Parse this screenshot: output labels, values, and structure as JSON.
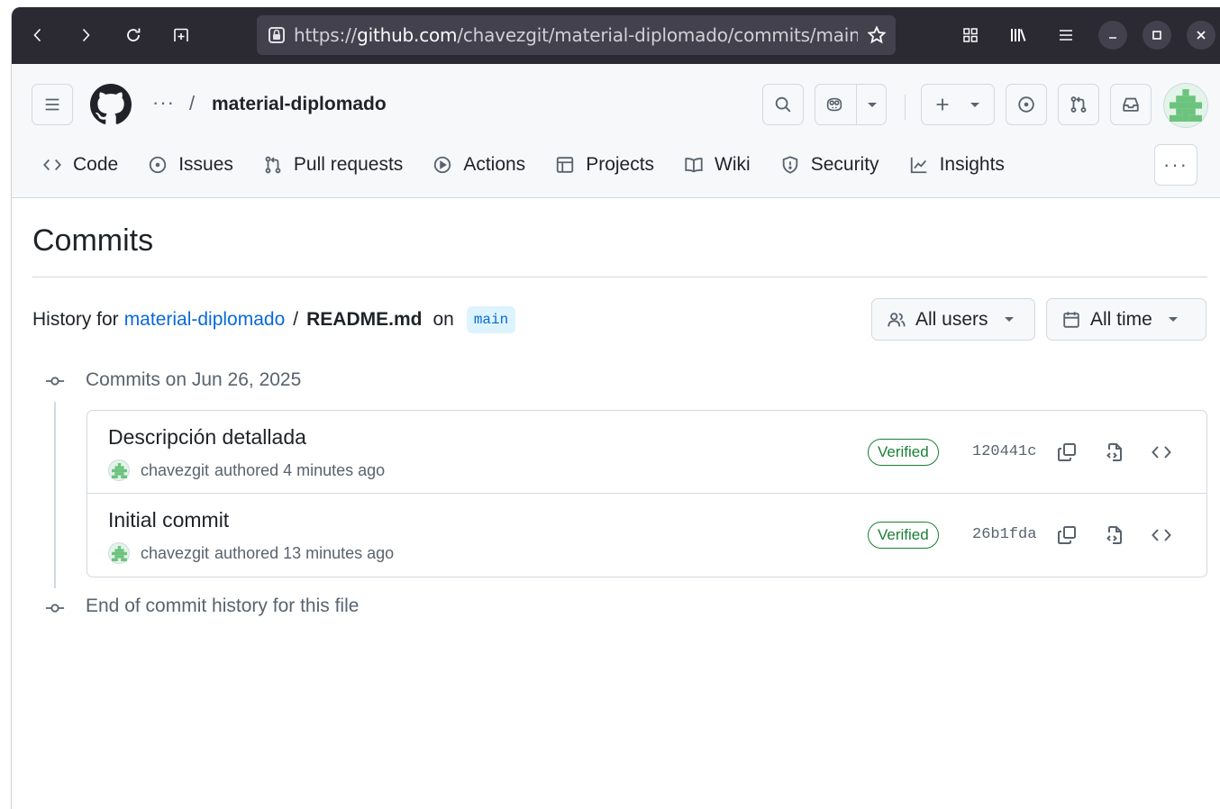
{
  "browser": {
    "url_prefix": "https://",
    "url_host": "github.com",
    "url_path": "/chavezgit/material-diplomado/commits/main/README.md"
  },
  "header": {
    "breadcrumb_dots": "···",
    "breadcrumb_slash": "/",
    "repo_name": "material-diplomado",
    "more_tabs": "···"
  },
  "tabs": [
    {
      "label": "Code",
      "icon": "code-icon"
    },
    {
      "label": "Issues",
      "icon": "issue-icon"
    },
    {
      "label": "Pull requests",
      "icon": "pull-request-icon"
    },
    {
      "label": "Actions",
      "icon": "play-icon"
    },
    {
      "label": "Projects",
      "icon": "table-icon"
    },
    {
      "label": "Wiki",
      "icon": "book-icon"
    },
    {
      "label": "Security",
      "icon": "shield-icon"
    },
    {
      "label": "Insights",
      "icon": "graph-icon"
    }
  ],
  "page": {
    "title": "Commits",
    "history_for": "History for",
    "repo_link": "material-diplomado",
    "separator": "/",
    "file": "README.md",
    "on": "on",
    "branch": "main",
    "filter_users": "All users",
    "filter_time": "All time",
    "group_label": "Commits on Jun 26, 2025",
    "end_label": "End of commit history for this file"
  },
  "commits": [
    {
      "title": "Descripción detallada",
      "author": "chavezgit",
      "time": "authored 4 minutes ago",
      "badge": "Verified",
      "sha": "120441c"
    },
    {
      "title": "Initial commit",
      "author": "chavezgit",
      "time": "authored 13 minutes ago",
      "badge": "Verified",
      "sha": "26b1fda"
    }
  ],
  "colors": {
    "link": "#0969da",
    "verified": "#1a7f37",
    "browser_chrome": "#2b2a33",
    "header_bg": "#f6f8fa"
  }
}
